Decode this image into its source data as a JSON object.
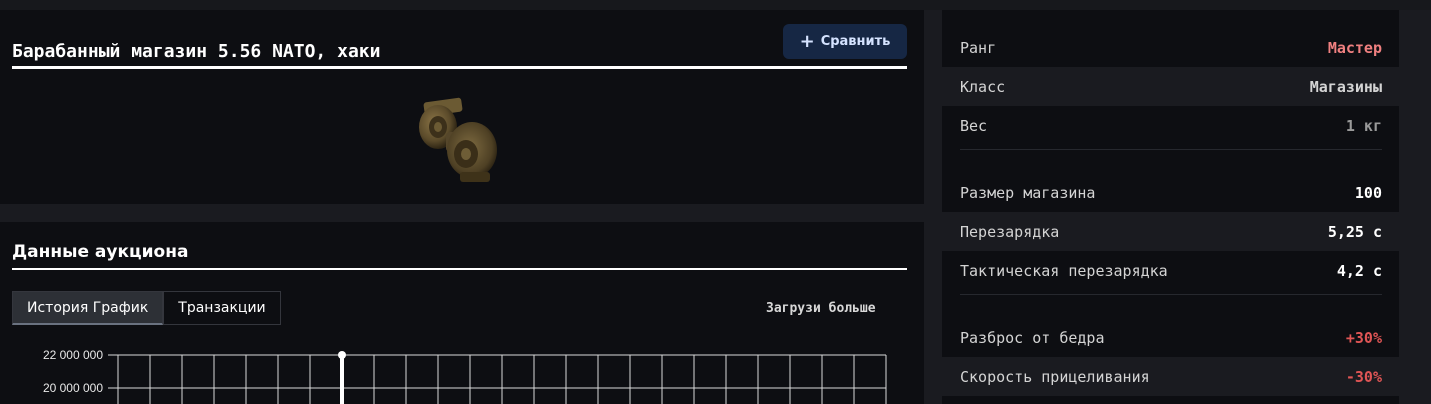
{
  "item": {
    "title": "Барабанный магазин 5.56 NATO, хаки",
    "compare_label": "Сравнить",
    "compare_icon": "plus-icon",
    "image": "drum-magazine-khaki"
  },
  "auction": {
    "title": "Данные аукциона",
    "tabs": [
      {
        "label": "История График",
        "active": true
      },
      {
        "label": "Транзакции",
        "active": false
      }
    ],
    "load_more": "Загрузи больше"
  },
  "chart_data": {
    "type": "line",
    "title": "",
    "xlabel": "",
    "ylabel": "",
    "y_ticks": [
      "22 000 000",
      "20 000 000"
    ],
    "grid": true,
    "series": [
      {
        "values": [
          22000000
        ],
        "x": [
          7
        ]
      }
    ],
    "x_count": 24
  },
  "stats": [
    {
      "label": "Ранг",
      "value": "Мастер",
      "color": "#f08080",
      "shaded": false
    },
    {
      "label": "Класс",
      "value": "Магазины",
      "color": "#d4d4d4",
      "shaded": true
    },
    {
      "label": "Вес",
      "value": "1 кг",
      "color": "#9a9a9a",
      "shaded": false
    },
    {
      "separator": true
    },
    {
      "label": "Размер магазина",
      "value": "100",
      "color": "#ffffff",
      "shaded": false
    },
    {
      "label": "Перезарядка",
      "value": "5,25 с",
      "color": "#ffffff",
      "shaded": true
    },
    {
      "label": "Тактическая перезарядка",
      "value": "4,2 с",
      "color": "#ffffff",
      "shaded": false
    },
    {
      "separator": true
    },
    {
      "label": "Разброс от бедра",
      "value": "+30%",
      "color": "#e05555",
      "shaded": false
    },
    {
      "label": "Скорость прицеливания",
      "value": "-30%",
      "color": "#e05555",
      "shaded": true
    }
  ]
}
